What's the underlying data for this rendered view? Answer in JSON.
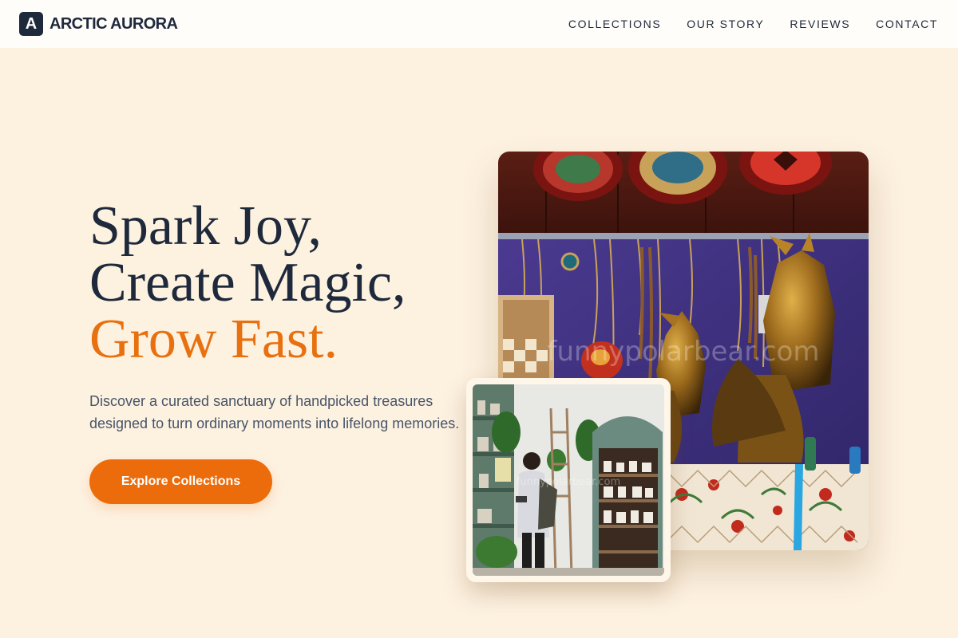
{
  "brand": {
    "logo_letter": "A",
    "name": "ARCTIC AURORA"
  },
  "nav": [
    {
      "label": "COLLECTIONS"
    },
    {
      "label": "OUR STORY"
    },
    {
      "label": "REVIEWS"
    },
    {
      "label": "CONTACT"
    }
  ],
  "hero": {
    "title_line1": "Spark Joy,",
    "title_line2": "Create Magic,",
    "title_line3": "Grow Fast.",
    "subtitle": "Discover a curated sanctuary of handpicked treasures designed to turn ordinary moments into lifelong memories.",
    "cta_label": "Explore Collections"
  },
  "images": {
    "main_watermark": "funnypolarbear.com",
    "secondary_watermark": "funnypolarbear.com"
  },
  "colors": {
    "page_background": "#fdf1e0",
    "header_background": "#fffdf9",
    "text_primary": "#1e293b",
    "accent": "#e8700e",
    "button": "#ec6c0b"
  }
}
